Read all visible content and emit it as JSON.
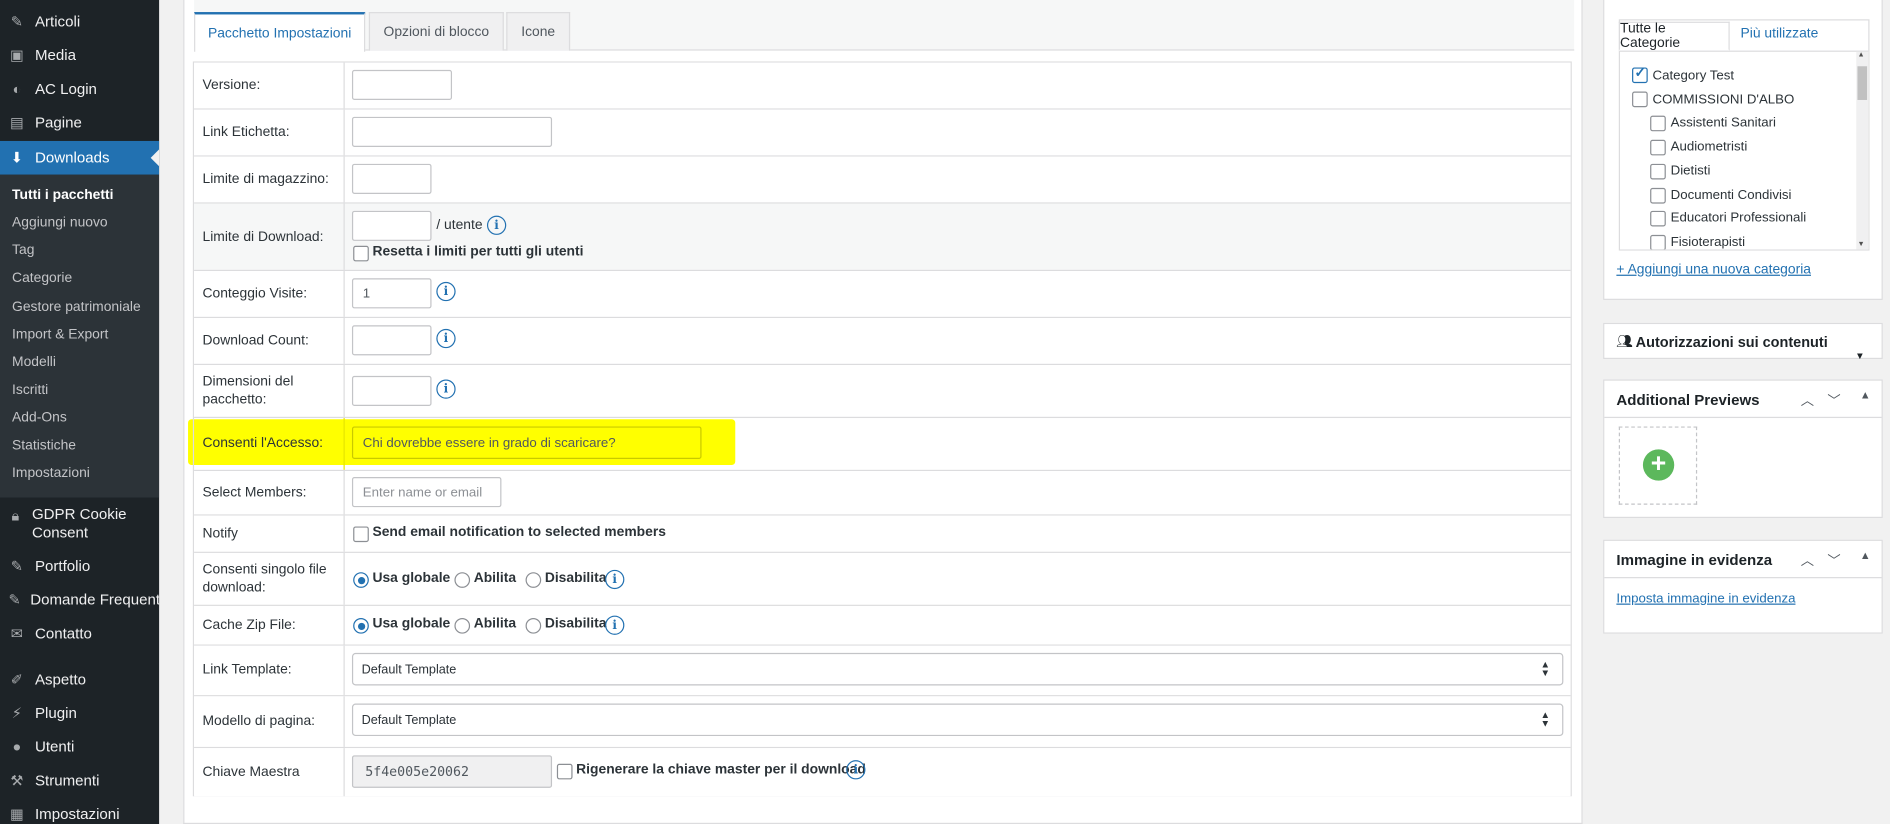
{
  "sidebar": {
    "items": [
      {
        "label": "Articoli",
        "icon": "pin-icon"
      },
      {
        "label": "Media",
        "icon": "media-icon"
      },
      {
        "label": "AC Login",
        "icon": "gauge-icon"
      },
      {
        "label": "Pagine",
        "icon": "pages-icon"
      },
      {
        "label": "Downloads",
        "icon": "download-icon"
      },
      {
        "label": "GDPR Cookie Consent",
        "icon": "lock-icon"
      },
      {
        "label": "Portfolio",
        "icon": "pin-icon"
      },
      {
        "label": "Domande Frequenti",
        "icon": "pin-icon"
      },
      {
        "label": "Contatto",
        "icon": "mail-icon"
      },
      {
        "label": "Aspetto",
        "icon": "brush-icon"
      },
      {
        "label": "Plugin",
        "icon": "plug-icon"
      },
      {
        "label": "Utenti",
        "icon": "user-icon"
      },
      {
        "label": "Strumenti",
        "icon": "wrench-icon"
      },
      {
        "label": "Impostazioni",
        "icon": "settings-icon"
      }
    ],
    "submenu": [
      "Tutti i pacchetti",
      "Aggiungi nuovo",
      "Tag",
      "Categorie",
      "Gestore patrimoniale",
      "Import & Export",
      "Modelli",
      "Iscritti",
      "Add-Ons",
      "Statistiche",
      "Impostazioni"
    ]
  },
  "tabs": [
    "Pacchetto Impostazioni",
    "Opzioni di blocco",
    "Icone"
  ],
  "form": {
    "versione": "Versione:",
    "link_etichetta": "Link Etichetta:",
    "limite_magazzino": "Limite di magazzino:",
    "limite_download": "Limite di Download:",
    "per_utente": "/ utente",
    "resetta": "Resetta i limiti per tutti gli utenti",
    "conteggio_visite": "Conteggio Visite:",
    "conteggio_value": "1",
    "download_count": "Download Count:",
    "dimensioni": "Dimensioni del pacchetto:",
    "consenti_accesso": "Consenti l'Accesso:",
    "accesso_placeholder": "Chi dovrebbe essere in grado di scaricare?",
    "select_members": "Select Members:",
    "members_placeholder": "Enter name or email",
    "notify": "Notify",
    "notify_label": "Send email notification to selected members",
    "consenti_singolo": "Consenti singolo file download:",
    "cache_zip": "Cache Zip File:",
    "opt_globale": "Usa globale",
    "opt_abilita": "Abilita",
    "opt_disabilita": "Disabilita",
    "link_template": "Link Template:",
    "link_template_value": "Default Template",
    "modello_pagina": "Modello di pagina:",
    "modello_value": "Default Template",
    "chiave_maestra": "Chiave Maestra",
    "chiave_value": "5f4e005e20062",
    "rigenerare": "Rigenerare la chiave master per il download",
    "info_glyph": "i"
  },
  "categorie": {
    "tabs": [
      "Tutte le Categorie",
      "Più utilizzate"
    ],
    "items": [
      {
        "label": "Category Test",
        "checked": true,
        "child": false
      },
      {
        "label": "COMMISSIONI D'ALBO",
        "checked": false,
        "child": false
      },
      {
        "label": "Assistenti Sanitari",
        "checked": false,
        "child": true
      },
      {
        "label": "Audiometristi",
        "checked": false,
        "child": true
      },
      {
        "label": "Dietisti",
        "checked": false,
        "child": true
      },
      {
        "label": "Documenti Condivisi",
        "checked": false,
        "child": true
      },
      {
        "label": "Educatori Professionali",
        "checked": false,
        "child": true
      },
      {
        "label": "Fisioterapisti",
        "checked": false,
        "child": true
      }
    ],
    "add_link": "+ Aggiungi una nuova categoria"
  },
  "autorizzazioni": {
    "title": "Autorizzazioni sui contenuti"
  },
  "additional_previews": {
    "title": "Additional Previews"
  },
  "immagine": {
    "title": "Immagine in evidenza",
    "link": "Imposta immagine in evidenza"
  },
  "colors": {
    "accent": "#2271b1",
    "sidebar": "#1d2327",
    "highlight": "#ffff00",
    "add_green": "#5cb85c"
  }
}
